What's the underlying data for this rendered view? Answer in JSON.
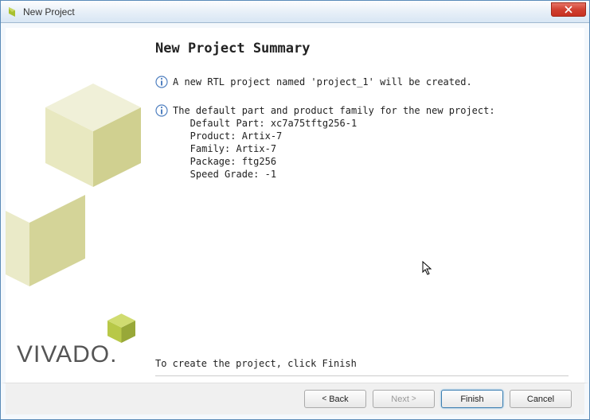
{
  "titlebar": {
    "text": "New Project"
  },
  "sidebar": {
    "brand": "VIVADO."
  },
  "main": {
    "heading": "New Project Summary",
    "info1": "A new RTL project named 'project_1' will be created.",
    "info2": "The default part and product family for the new project:\n   Default Part: xc7a75tftg256-1\n   Product: Artix-7\n   Family: Artix-7\n   Package: ftg256\n   Speed Grade: -1",
    "footer": "To create the project, click Finish"
  },
  "buttons": {
    "back": "Back",
    "next": "Next",
    "finish": "Finish",
    "cancel": "Cancel"
  }
}
